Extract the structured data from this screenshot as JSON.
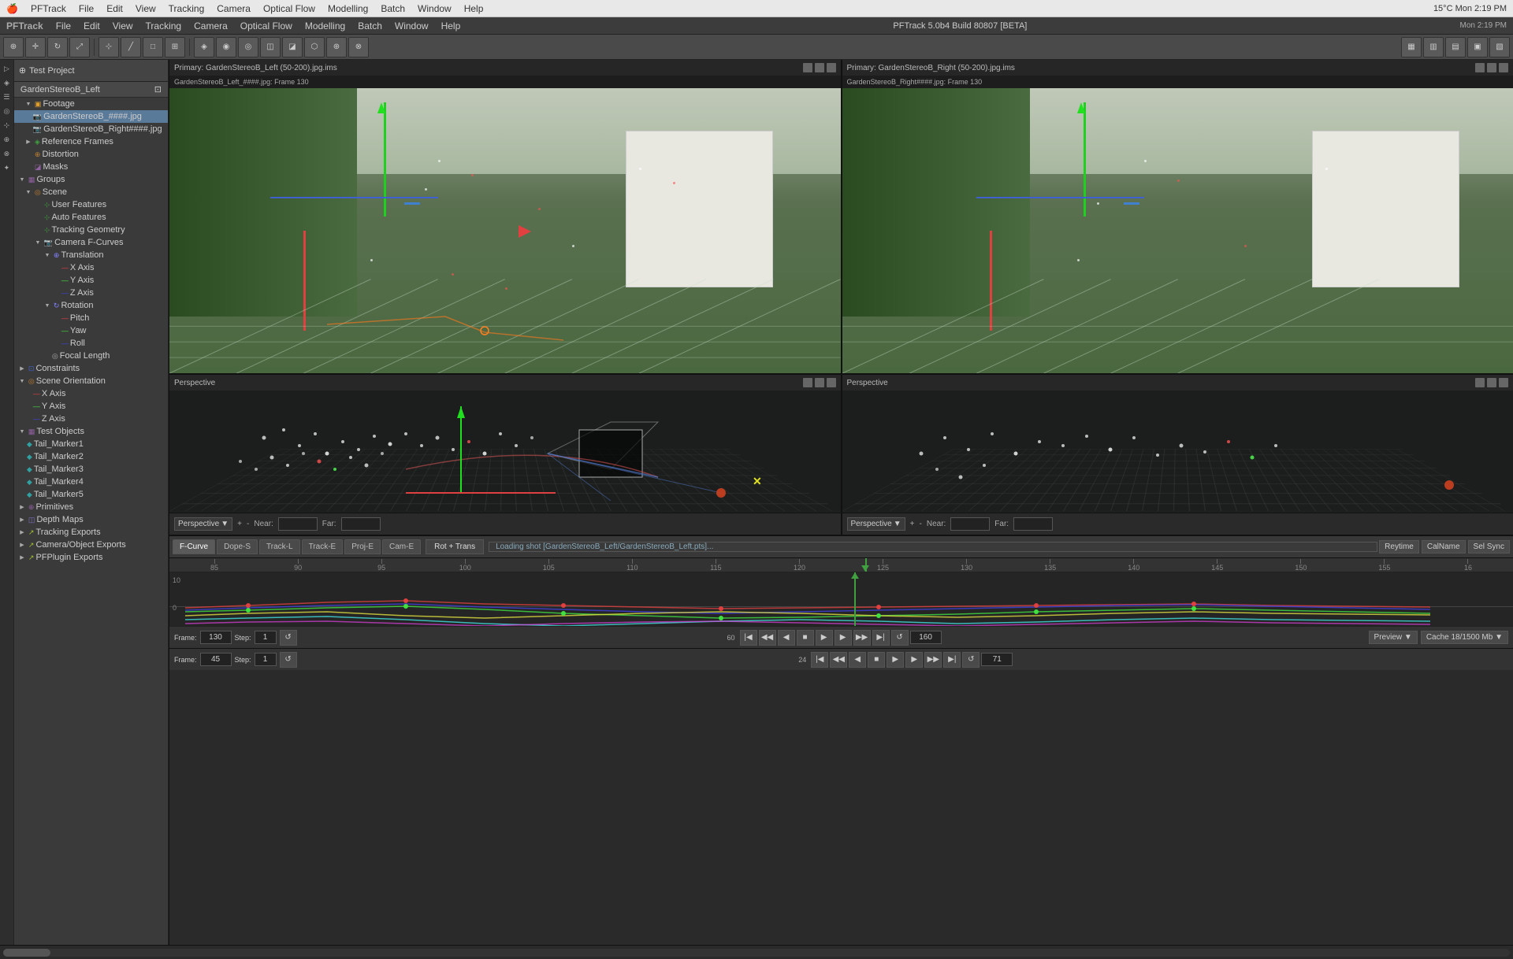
{
  "app": {
    "name": "PFTrack",
    "version": "5.0b4 Build 80807 [BETA]",
    "window_title": "PFTrack 5.0b4 Build 80807 [BETA]"
  },
  "menu1": {
    "items": [
      "PFTrack",
      "File",
      "Edit",
      "View",
      "Tracking",
      "Camera",
      "Optical Flow",
      "Modelling",
      "Batch",
      "Window",
      "Help"
    ],
    "right_info": "15°C  Mon 2:19 PM"
  },
  "menu2": {
    "items": [
      "PFTrack",
      "File",
      "Edit",
      "View",
      "Tracking",
      "Camera",
      "Optical Flow",
      "Modelling",
      "Batch",
      "Window",
      "Help"
    ],
    "window_title": "PFTrack 5.0b4 Build 80807 [BETA]"
  },
  "sidebar": {
    "project_name": "Test Project",
    "camera_name": "GardenStereoB_Left",
    "tree_items": [
      {
        "id": "footage",
        "label": "Footage",
        "indent": 1,
        "icon": "footage",
        "expanded": true
      },
      {
        "id": "footage-left",
        "label": "GardenStereoB_####.jpg",
        "indent": 2,
        "icon": "camera",
        "selected": true
      },
      {
        "id": "footage-right",
        "label": "GardenStereoB_Right####.jpg",
        "indent": 2,
        "icon": "camera"
      },
      {
        "id": "reference-frames",
        "label": "Reference Frames",
        "indent": 1,
        "icon": "feature"
      },
      {
        "id": "distortion",
        "label": "Distortion",
        "indent": 1,
        "icon": "scene"
      },
      {
        "id": "masks",
        "label": "Masks",
        "indent": 1,
        "icon": "group"
      },
      {
        "id": "groups",
        "label": "Groups",
        "indent": 0,
        "icon": "group",
        "expanded": true
      },
      {
        "id": "scene",
        "label": "Scene",
        "indent": 1,
        "icon": "scene",
        "expanded": true
      },
      {
        "id": "user-features",
        "label": "User Features",
        "indent": 2,
        "icon": "feature"
      },
      {
        "id": "auto-features",
        "label": "Auto Features",
        "indent": 2,
        "icon": "feature"
      },
      {
        "id": "tracking-geometry",
        "label": "Tracking Geometry",
        "indent": 2,
        "icon": "feature"
      },
      {
        "id": "camera-f-curves",
        "label": "Camera F-Curves",
        "indent": 2,
        "icon": "camera",
        "expanded": true
      },
      {
        "id": "translation",
        "label": "Translation",
        "indent": 3,
        "icon": "axis",
        "expanded": true
      },
      {
        "id": "x-axis",
        "label": "X Axis",
        "indent": 4,
        "icon": "axis"
      },
      {
        "id": "y-axis",
        "label": "Y Axis",
        "indent": 4,
        "icon": "axis"
      },
      {
        "id": "z-axis",
        "label": "Z Axis",
        "indent": 4,
        "icon": "axis"
      },
      {
        "id": "rotation",
        "label": "Rotation",
        "indent": 3,
        "icon": "axis",
        "expanded": true
      },
      {
        "id": "pitch",
        "label": "Pitch",
        "indent": 4,
        "icon": "axis"
      },
      {
        "id": "yaw",
        "label": "Yaw",
        "indent": 4,
        "icon": "axis"
      },
      {
        "id": "roll",
        "label": "Roll",
        "indent": 4,
        "icon": "axis"
      },
      {
        "id": "focal-length",
        "label": "Focal Length",
        "indent": 3,
        "icon": "axis"
      },
      {
        "id": "constraints",
        "label": "Constraints",
        "indent": 0,
        "icon": "constraint"
      },
      {
        "id": "scene-orientation",
        "label": "Scene Orientation",
        "indent": 0,
        "icon": "scene",
        "expanded": true
      },
      {
        "id": "so-x-axis",
        "label": "X Axis",
        "indent": 1,
        "icon": "axis"
      },
      {
        "id": "so-y-axis",
        "label": "Y Axis",
        "indent": 1,
        "icon": "axis"
      },
      {
        "id": "so-z-axis",
        "label": "Z Axis",
        "indent": 1,
        "icon": "axis"
      },
      {
        "id": "test-objects",
        "label": "Test Objects",
        "indent": 0,
        "icon": "group",
        "expanded": true
      },
      {
        "id": "tail-marker1",
        "label": "Tail_Marker1",
        "indent": 1,
        "icon": "marker"
      },
      {
        "id": "tail-marker2",
        "label": "Tail_Marker2",
        "indent": 1,
        "icon": "marker"
      },
      {
        "id": "tail-marker3",
        "label": "Tail_Marker3",
        "indent": 1,
        "icon": "marker"
      },
      {
        "id": "tail-marker4",
        "label": "Tail_Marker4",
        "indent": 1,
        "icon": "marker"
      },
      {
        "id": "tail-marker5",
        "label": "Tail_Marker5",
        "indent": 1,
        "icon": "marker"
      },
      {
        "id": "primitives",
        "label": "Primitives",
        "indent": 0,
        "icon": "group"
      },
      {
        "id": "depth-maps",
        "label": "Depth Maps",
        "indent": 0,
        "icon": "depth"
      },
      {
        "id": "tracking-exports",
        "label": "Tracking Exports",
        "indent": 0,
        "icon": "export"
      },
      {
        "id": "camera-object-exports",
        "label": "Camera/Object Exports",
        "indent": 0,
        "icon": "export"
      },
      {
        "id": "pfplugin-exports",
        "label": "PFPlugin Exports",
        "indent": 0,
        "icon": "export"
      }
    ]
  },
  "viewports": {
    "top_left": {
      "title": "Primary: GardenStereoB_Left (50-200).jpg.ims",
      "subtitle": "GardenStereoB_Left_####.jpg: Frame 130"
    },
    "top_right": {
      "title": "Primary: GardenStereoB_Right (50-200).jpg.ims",
      "subtitle": "GardenStereoB_Right####.jpg: Frame 130"
    },
    "bottom_left": {
      "title": "Perspective",
      "near_label": "Near:",
      "far_label": "Far:",
      "perspective_mode": "Perspective"
    },
    "bottom_right": {
      "title": "Perspective",
      "near_label": "Near:",
      "far_label": "Far:",
      "perspective_mode": "Perspective"
    }
  },
  "timeline": {
    "tabs": [
      "F-Curve",
      "Dope-S",
      "Track-L",
      "Track-E",
      "Proj-E",
      "Cam-E"
    ],
    "active_tab": "F-Curve",
    "mode": "Rot + Trans",
    "status_text": "Loading shot [GardenStereoB_Left/GardenStereoB_Left.pts]...",
    "right_buttons": [
      "Reytime",
      "CalName",
      "Sel Sync"
    ],
    "ruler_marks": [
      "85",
      "90",
      "95",
      "100",
      "105",
      "110",
      "115",
      "120",
      "125",
      "130",
      "135",
      "140",
      "145",
      "150",
      "155",
      "16"
    ],
    "controls_row1": {
      "frame_label": "Frame:",
      "frame_value": "130",
      "step_label": "Step:",
      "step_value": "1",
      "end_frame": "160",
      "preview_label": "Preview",
      "cache_label": "Cache 18/1500 Mb"
    },
    "controls_row2": {
      "frame_label": "Frame:",
      "frame_value": "45",
      "step_label": "Step:",
      "step_value": "1",
      "end_frame": "71"
    }
  },
  "transport_buttons": {
    "go_start": "|◀",
    "prev": "◀",
    "stop": "■",
    "play": "▶",
    "next": "▶|",
    "go_end": "▶|",
    "loop": "↺"
  }
}
